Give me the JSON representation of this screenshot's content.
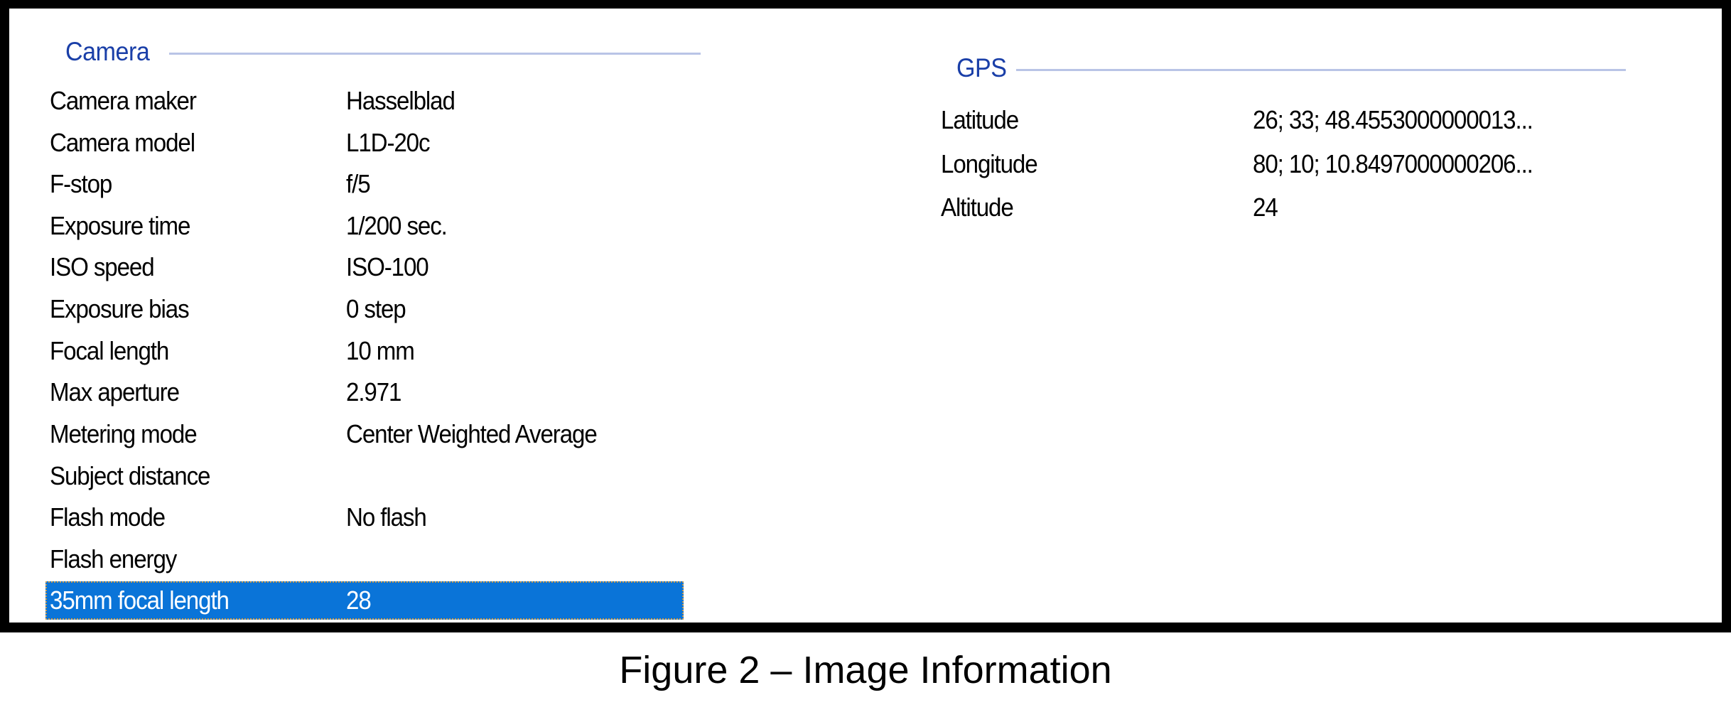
{
  "camera": {
    "title": "Camera",
    "rows": [
      {
        "label": "Camera maker",
        "value": "Hasselblad"
      },
      {
        "label": "Camera model",
        "value": "L1D-20c"
      },
      {
        "label": "F-stop",
        "value": "f/5"
      },
      {
        "label": "Exposure time",
        "value": "1/200 sec."
      },
      {
        "label": "ISO speed",
        "value": "ISO-100"
      },
      {
        "label": "Exposure bias",
        "value": "0 step"
      },
      {
        "label": "Focal length",
        "value": "10 mm"
      },
      {
        "label": "Max aperture",
        "value": "2.971"
      },
      {
        "label": "Metering mode",
        "value": "Center Weighted Average"
      },
      {
        "label": "Subject distance",
        "value": ""
      },
      {
        "label": "Flash mode",
        "value": "No flash"
      },
      {
        "label": "Flash energy",
        "value": ""
      },
      {
        "label": "35mm focal length",
        "value": "28",
        "selected": true
      }
    ]
  },
  "gps": {
    "title": "GPS",
    "rows": [
      {
        "label": "Latitude",
        "value": "26; 33; 48.4553000000013..."
      },
      {
        "label": "Longitude",
        "value": "80; 10; 10.8497000000206..."
      },
      {
        "label": "Altitude",
        "value": "24"
      }
    ]
  },
  "caption": "Figure 2 – Image Information",
  "colors": {
    "group_title": "#1a3fa8",
    "group_line": "#b9c4e6",
    "selection": "#0a74d8",
    "frame": "#000000"
  }
}
